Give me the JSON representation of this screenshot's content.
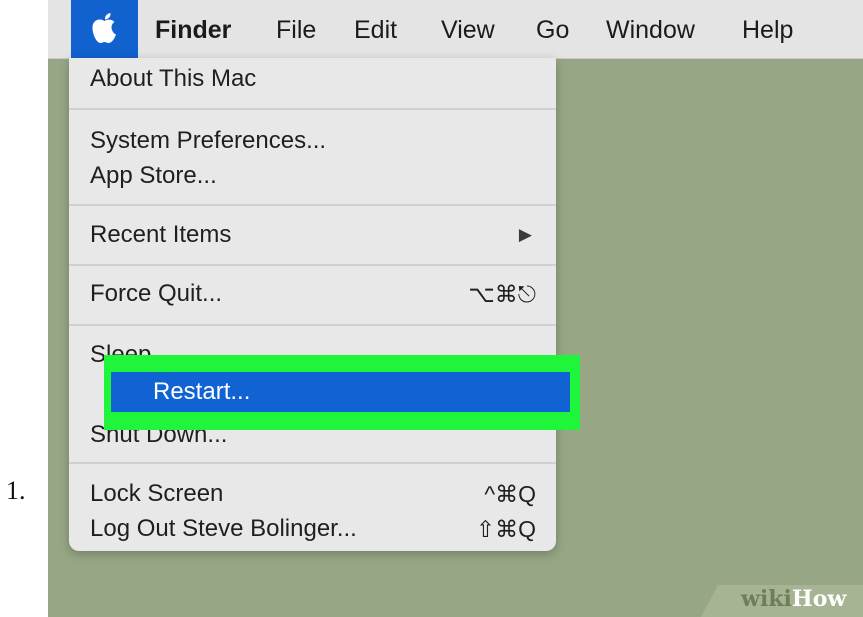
{
  "list_marker": "1.",
  "menubar": {
    "apple_icon": "apple-logo-icon",
    "items": [
      "Finder",
      "File",
      "Edit",
      "View",
      "Go",
      "Window",
      "Help"
    ]
  },
  "apple_menu": {
    "items": [
      {
        "label": "About This Mac",
        "shortcut": ""
      },
      {
        "label": "System Preferences...",
        "shortcut": ""
      },
      {
        "label": "App Store...",
        "shortcut": ""
      },
      {
        "label": "Recent Items",
        "shortcut": "▶"
      },
      {
        "label": "Force Quit...",
        "shortcut": "⌥⌘⎋"
      },
      {
        "label": "Sleep",
        "shortcut": ""
      },
      {
        "label": "Restart...",
        "shortcut": "",
        "highlighted": true
      },
      {
        "label": "Shut Down...",
        "shortcut": ""
      },
      {
        "label": "Lock Screen",
        "shortcut": "^⌘Q"
      },
      {
        "label": "Log Out Steve Bolinger...",
        "shortcut": "⇧⌘Q"
      }
    ]
  },
  "colors": {
    "selection": "#1163d4",
    "highlight_frame": "#1ff53a",
    "desktop": "#97a785",
    "menubar": "#e4e4e4"
  },
  "watermark": {
    "part1": "wiki",
    "part2": "How"
  }
}
